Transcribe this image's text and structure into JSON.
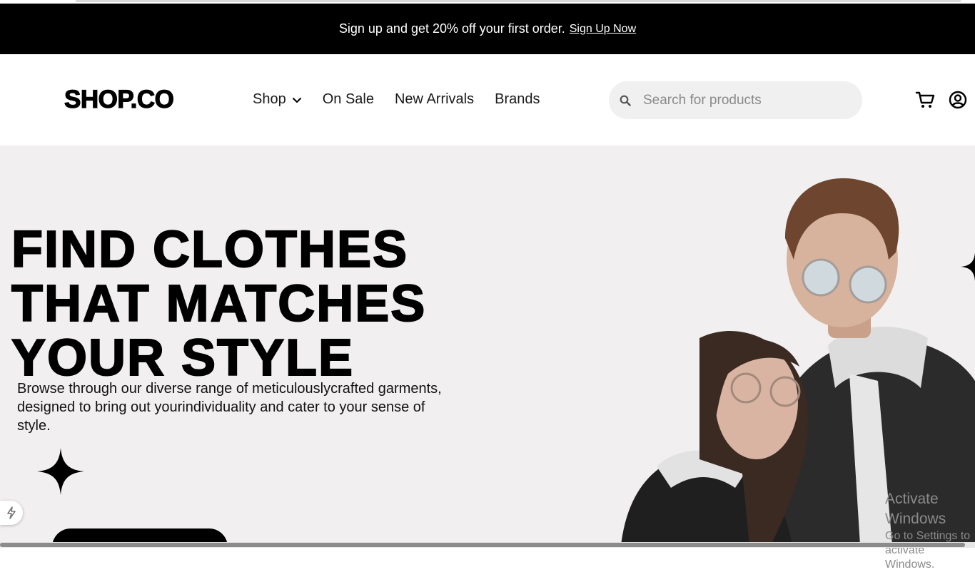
{
  "promo": {
    "text": "Sign up and get 20% off your first order.",
    "link_label": "Sign Up Now"
  },
  "header": {
    "logo": "SHOP.CO",
    "nav": [
      {
        "label": "Shop",
        "has_dropdown": true
      },
      {
        "label": "On Sale"
      },
      {
        "label": "New Arrivals"
      },
      {
        "label": "Brands"
      }
    ],
    "search": {
      "placeholder": "Search for products",
      "value": ""
    },
    "icons": [
      "search-icon",
      "cart-icon",
      "user-account-icon"
    ]
  },
  "hero": {
    "title": "FIND CLOTHES\nTHAT MATCHES\nYOUR STYLE",
    "description": "Browse through our diverse range of meticulouslycrafted garments, designed to bring out yourindividuality and cater to your sense of style.",
    "decor_icons": [
      "sparkle-star-icon"
    ]
  },
  "watermark": {
    "line1": "Activate Windows",
    "line2": "Go to Settings to activate Windows."
  },
  "colors": {
    "promo_bg": "#000000",
    "hero_bg": "#f1eff0",
    "search_bg": "#f0f0f0",
    "text": "#000000"
  }
}
